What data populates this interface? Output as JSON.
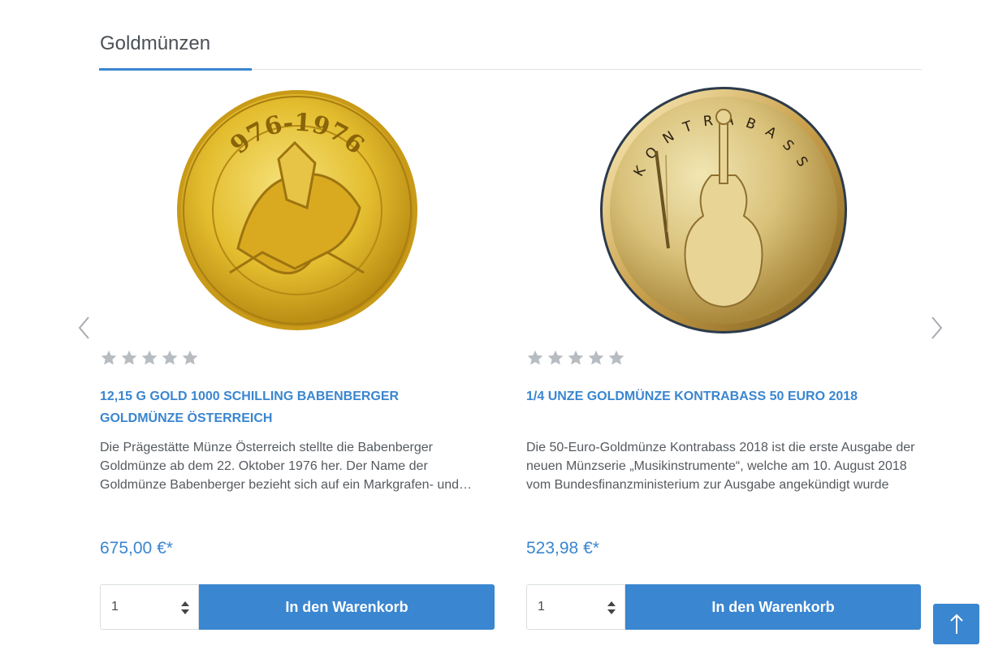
{
  "section": {
    "title": "Goldmünzen"
  },
  "nav": {
    "prev_icon": "chevron-left-icon",
    "next_icon": "chevron-right-icon"
  },
  "products": [
    {
      "image_icon": "gold-coin-babenberger",
      "coin_text_top": "976-1976",
      "rating_stars": 0,
      "rating_max": 5,
      "title": "12,15 g Gold 1000 Schilling Babenberger Goldmünze Österreich",
      "description": "Die Prägestätte Münze Österreich stellte die Babenberger Goldmünze ab dem 22. Oktober 1976 her. Der Name der Goldmünze Babenberger bezieht sich auf ein Markgrafen- und Herzogsgeschlecht",
      "price": "675,00 €*",
      "quantity": "1",
      "buy_label": "In den Warenkorb"
    },
    {
      "image_icon": "gold-coin-kontrabass",
      "coin_text_top": "KONTRABASS",
      "rating_stars": 0,
      "rating_max": 5,
      "title": "1/4 Unze Goldmünze Kontrabass 50 Euro 2018",
      "description": "Die 50-Euro-Goldmünze Kontrabass 2018 ist die erste Ausgabe der neuen Münzserie „Musikinstrumente“, welche am 10. August 2018 vom Bundesfinanzministerium zur Ausgabe angekündigt wurde",
      "price": "523,98 €*",
      "quantity": "1",
      "buy_label": "In den Warenkorb"
    }
  ],
  "scroll_top": {
    "icon": "arrow-up-icon"
  },
  "colors": {
    "accent": "#3a86d0",
    "star": "#b7bcc1",
    "text": "#555a5f"
  }
}
